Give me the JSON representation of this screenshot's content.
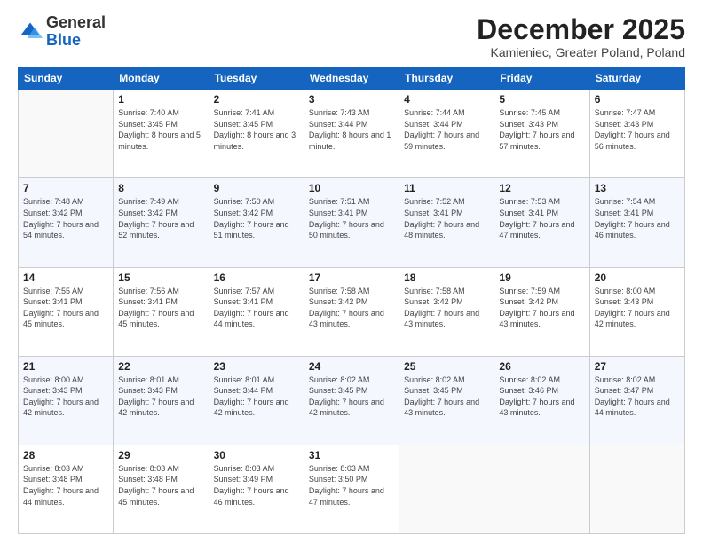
{
  "logo": {
    "general": "General",
    "blue": "Blue"
  },
  "title": "December 2025",
  "location": "Kamieniec, Greater Poland, Poland",
  "days_header": [
    "Sunday",
    "Monday",
    "Tuesday",
    "Wednesday",
    "Thursday",
    "Friday",
    "Saturday"
  ],
  "weeks": [
    [
      {
        "day": "",
        "sunrise": "",
        "sunset": "",
        "daylight": ""
      },
      {
        "day": "1",
        "sunrise": "Sunrise: 7:40 AM",
        "sunset": "Sunset: 3:45 PM",
        "daylight": "Daylight: 8 hours and 5 minutes."
      },
      {
        "day": "2",
        "sunrise": "Sunrise: 7:41 AM",
        "sunset": "Sunset: 3:45 PM",
        "daylight": "Daylight: 8 hours and 3 minutes."
      },
      {
        "day": "3",
        "sunrise": "Sunrise: 7:43 AM",
        "sunset": "Sunset: 3:44 PM",
        "daylight": "Daylight: 8 hours and 1 minute."
      },
      {
        "day": "4",
        "sunrise": "Sunrise: 7:44 AM",
        "sunset": "Sunset: 3:44 PM",
        "daylight": "Daylight: 7 hours and 59 minutes."
      },
      {
        "day": "5",
        "sunrise": "Sunrise: 7:45 AM",
        "sunset": "Sunset: 3:43 PM",
        "daylight": "Daylight: 7 hours and 57 minutes."
      },
      {
        "day": "6",
        "sunrise": "Sunrise: 7:47 AM",
        "sunset": "Sunset: 3:43 PM",
        "daylight": "Daylight: 7 hours and 56 minutes."
      }
    ],
    [
      {
        "day": "7",
        "sunrise": "Sunrise: 7:48 AM",
        "sunset": "Sunset: 3:42 PM",
        "daylight": "Daylight: 7 hours and 54 minutes."
      },
      {
        "day": "8",
        "sunrise": "Sunrise: 7:49 AM",
        "sunset": "Sunset: 3:42 PM",
        "daylight": "Daylight: 7 hours and 52 minutes."
      },
      {
        "day": "9",
        "sunrise": "Sunrise: 7:50 AM",
        "sunset": "Sunset: 3:42 PM",
        "daylight": "Daylight: 7 hours and 51 minutes."
      },
      {
        "day": "10",
        "sunrise": "Sunrise: 7:51 AM",
        "sunset": "Sunset: 3:41 PM",
        "daylight": "Daylight: 7 hours and 50 minutes."
      },
      {
        "day": "11",
        "sunrise": "Sunrise: 7:52 AM",
        "sunset": "Sunset: 3:41 PM",
        "daylight": "Daylight: 7 hours and 48 minutes."
      },
      {
        "day": "12",
        "sunrise": "Sunrise: 7:53 AM",
        "sunset": "Sunset: 3:41 PM",
        "daylight": "Daylight: 7 hours and 47 minutes."
      },
      {
        "day": "13",
        "sunrise": "Sunrise: 7:54 AM",
        "sunset": "Sunset: 3:41 PM",
        "daylight": "Daylight: 7 hours and 46 minutes."
      }
    ],
    [
      {
        "day": "14",
        "sunrise": "Sunrise: 7:55 AM",
        "sunset": "Sunset: 3:41 PM",
        "daylight": "Daylight: 7 hours and 45 minutes."
      },
      {
        "day": "15",
        "sunrise": "Sunrise: 7:56 AM",
        "sunset": "Sunset: 3:41 PM",
        "daylight": "Daylight: 7 hours and 45 minutes."
      },
      {
        "day": "16",
        "sunrise": "Sunrise: 7:57 AM",
        "sunset": "Sunset: 3:41 PM",
        "daylight": "Daylight: 7 hours and 44 minutes."
      },
      {
        "day": "17",
        "sunrise": "Sunrise: 7:58 AM",
        "sunset": "Sunset: 3:42 PM",
        "daylight": "Daylight: 7 hours and 43 minutes."
      },
      {
        "day": "18",
        "sunrise": "Sunrise: 7:58 AM",
        "sunset": "Sunset: 3:42 PM",
        "daylight": "Daylight: 7 hours and 43 minutes."
      },
      {
        "day": "19",
        "sunrise": "Sunrise: 7:59 AM",
        "sunset": "Sunset: 3:42 PM",
        "daylight": "Daylight: 7 hours and 43 minutes."
      },
      {
        "day": "20",
        "sunrise": "Sunrise: 8:00 AM",
        "sunset": "Sunset: 3:43 PM",
        "daylight": "Daylight: 7 hours and 42 minutes."
      }
    ],
    [
      {
        "day": "21",
        "sunrise": "Sunrise: 8:00 AM",
        "sunset": "Sunset: 3:43 PM",
        "daylight": "Daylight: 7 hours and 42 minutes."
      },
      {
        "day": "22",
        "sunrise": "Sunrise: 8:01 AM",
        "sunset": "Sunset: 3:43 PM",
        "daylight": "Daylight: 7 hours and 42 minutes."
      },
      {
        "day": "23",
        "sunrise": "Sunrise: 8:01 AM",
        "sunset": "Sunset: 3:44 PM",
        "daylight": "Daylight: 7 hours and 42 minutes."
      },
      {
        "day": "24",
        "sunrise": "Sunrise: 8:02 AM",
        "sunset": "Sunset: 3:45 PM",
        "daylight": "Daylight: 7 hours and 42 minutes."
      },
      {
        "day": "25",
        "sunrise": "Sunrise: 8:02 AM",
        "sunset": "Sunset: 3:45 PM",
        "daylight": "Daylight: 7 hours and 43 minutes."
      },
      {
        "day": "26",
        "sunrise": "Sunrise: 8:02 AM",
        "sunset": "Sunset: 3:46 PM",
        "daylight": "Daylight: 7 hours and 43 minutes."
      },
      {
        "day": "27",
        "sunrise": "Sunrise: 8:02 AM",
        "sunset": "Sunset: 3:47 PM",
        "daylight": "Daylight: 7 hours and 44 minutes."
      }
    ],
    [
      {
        "day": "28",
        "sunrise": "Sunrise: 8:03 AM",
        "sunset": "Sunset: 3:48 PM",
        "daylight": "Daylight: 7 hours and 44 minutes."
      },
      {
        "day": "29",
        "sunrise": "Sunrise: 8:03 AM",
        "sunset": "Sunset: 3:48 PM",
        "daylight": "Daylight: 7 hours and 45 minutes."
      },
      {
        "day": "30",
        "sunrise": "Sunrise: 8:03 AM",
        "sunset": "Sunset: 3:49 PM",
        "daylight": "Daylight: 7 hours and 46 minutes."
      },
      {
        "day": "31",
        "sunrise": "Sunrise: 8:03 AM",
        "sunset": "Sunset: 3:50 PM",
        "daylight": "Daylight: 7 hours and 47 minutes."
      },
      {
        "day": "",
        "sunrise": "",
        "sunset": "",
        "daylight": ""
      },
      {
        "day": "",
        "sunrise": "",
        "sunset": "",
        "daylight": ""
      },
      {
        "day": "",
        "sunrise": "",
        "sunset": "",
        "daylight": ""
      }
    ]
  ]
}
